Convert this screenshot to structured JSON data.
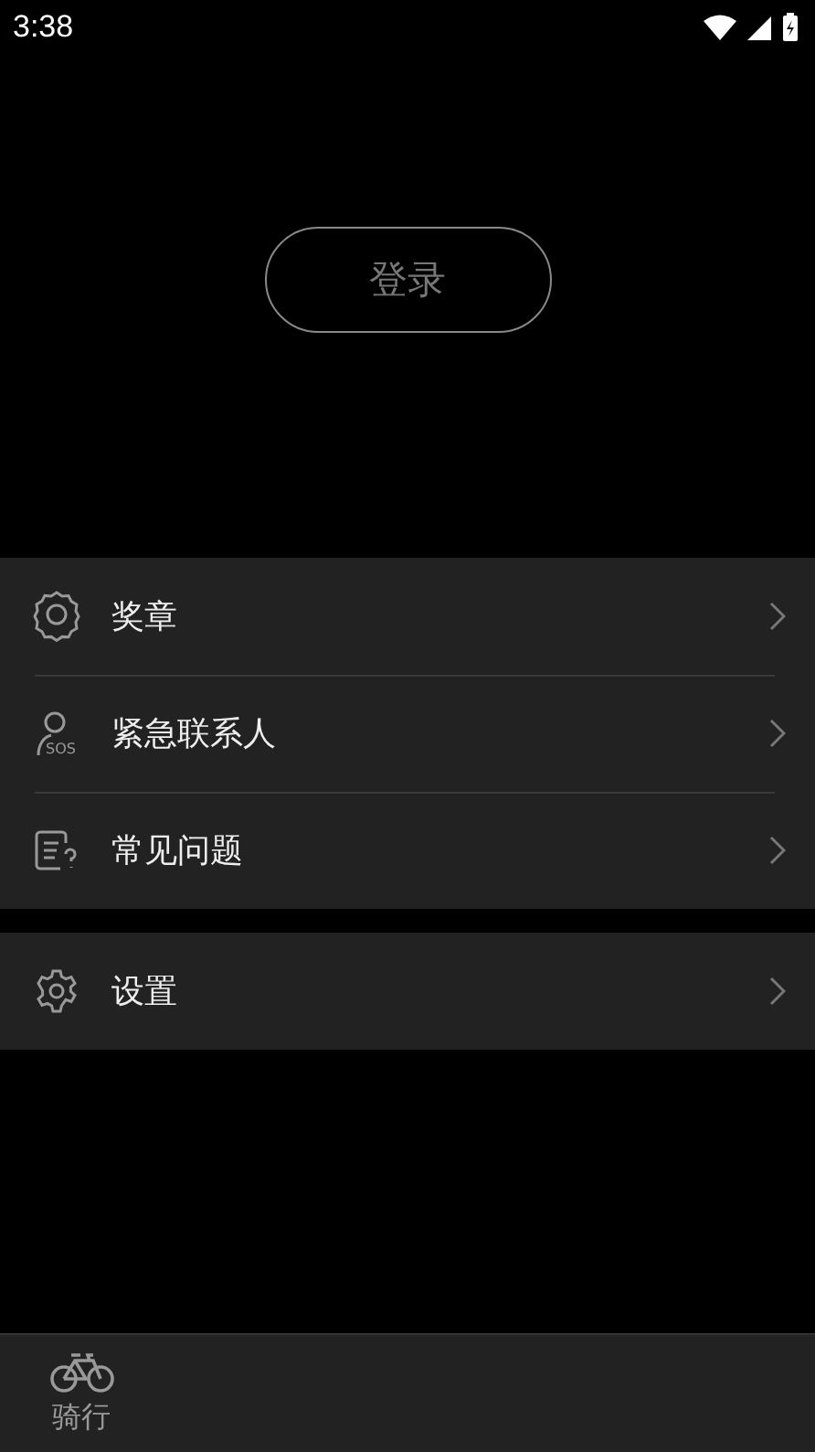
{
  "status_bar": {
    "time": "3:38"
  },
  "login_button": {
    "label": "登录"
  },
  "menu_groups": [
    {
      "items": [
        {
          "label": "奖章"
        },
        {
          "label": "紧急联系人",
          "icon_text": "SOS"
        },
        {
          "label": "常见问题"
        }
      ]
    },
    {
      "items": [
        {
          "label": "设置"
        }
      ]
    }
  ],
  "bottom_nav": [
    {
      "label": "骑行",
      "selected": false
    }
  ]
}
